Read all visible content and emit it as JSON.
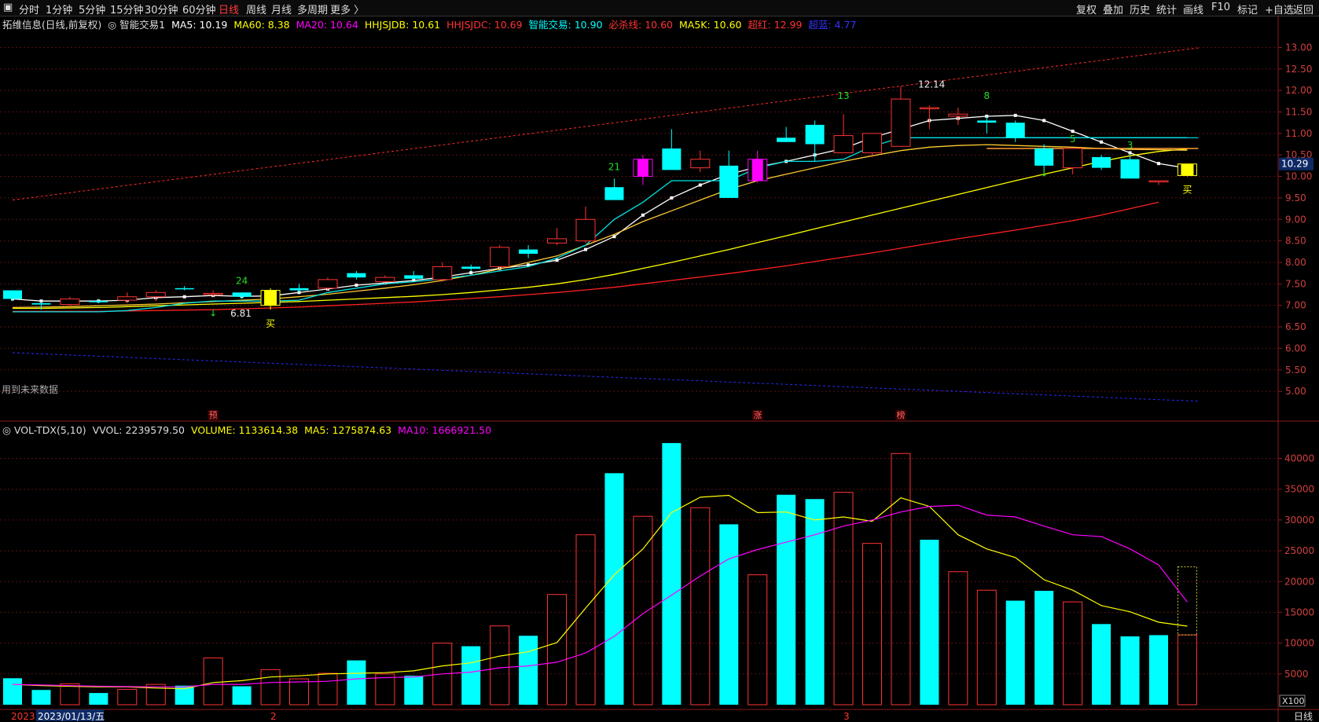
{
  "toolbar": {
    "left": [
      "分时",
      "1分钟",
      "5分钟",
      "15分钟",
      "30分钟",
      "60分钟",
      "日线",
      "周线",
      "月线",
      "多周期",
      "更多 〉"
    ],
    "active": "日线",
    "right": [
      "复权",
      "叠加",
      "历史",
      "统计",
      "画线",
      "F10",
      "标记",
      "+自选",
      "返回"
    ]
  },
  "main_legend": [
    {
      "text": "拓维信息(日线,前复权)",
      "color": "#dddddd"
    },
    {
      "text": "◎ 智能交易1",
      "color": "#dddddd"
    },
    {
      "text": "MA5: 10.19",
      "color": "#ffffff"
    },
    {
      "text": "MA60: 8.38",
      "color": "#ffff00"
    },
    {
      "text": "MA20: 10.64",
      "color": "#ff00ff"
    },
    {
      "text": "HHJSJDB: 10.61",
      "color": "#ffff00"
    },
    {
      "text": "HHJSJDC: 10.69",
      "color": "#ff3333"
    },
    {
      "text": "智能交易: 10.90",
      "color": "#00ffff"
    },
    {
      "text": "必杀线: 10.60",
      "color": "#ff3333"
    },
    {
      "text": "MA5K: 10.60",
      "color": "#ffff00"
    },
    {
      "text": "超红: 12.99",
      "color": "#ff3333"
    },
    {
      "text": "超蓝: 4.77",
      "color": "#3333ff"
    }
  ],
  "vol_legend": [
    {
      "text": "◎ VOL-TDX(5,10)",
      "color": "#dddddd"
    },
    {
      "text": "VVOL: 2239579.50",
      "color": "#dddddd"
    },
    {
      "text": "VOLUME: 1133614.38",
      "color": "#ffff00"
    },
    {
      "text": "MA5: 1275874.63",
      "color": "#ffff00"
    },
    {
      "text": "MA10: 1666921.50",
      "color": "#ff00ff"
    }
  ],
  "notes": {
    "future_data": "用到未来数据",
    "high_label": "12.14",
    "low_label": "6.81",
    "buy_label": "买",
    "last_price": "10.29",
    "vol_unit": "X100",
    "period": "日线",
    "markers": [
      "预",
      "涨",
      "榜"
    ],
    "signal_numbers": [
      "24",
      "21",
      "13",
      "8",
      "5",
      "3"
    ]
  },
  "x_axis": {
    "labels": [
      "2023",
      "2023/01/13/五",
      "2",
      "3"
    ]
  },
  "chart_data": [
    {
      "type": "candlestick",
      "title": "拓维信息(日线,前复权)",
      "ylim": [
        4.6,
        13.3
      ],
      "yticks": [
        "13.00",
        "12.50",
        "12.00",
        "11.50",
        "11.00",
        "10.50",
        "10.00",
        "9.50",
        "9.00",
        "8.50",
        "8.00",
        "7.50",
        "7.00",
        "6.50",
        "6.00",
        "5.50",
        "5.00"
      ],
      "ohlc": [
        [
          7.35,
          7.35,
          7.1,
          7.15
        ],
        [
          7.05,
          7.1,
          6.9,
          7.02
        ],
        [
          7.02,
          7.2,
          6.95,
          7.15
        ],
        [
          7.1,
          7.15,
          7.05,
          7.08
        ],
        [
          7.12,
          7.3,
          7.05,
          7.2
        ],
        [
          7.2,
          7.35,
          7.1,
          7.3
        ],
        [
          7.4,
          7.45,
          7.35,
          7.38
        ],
        [
          7.25,
          7.35,
          7.2,
          7.28
        ],
        [
          7.3,
          7.3,
          7.15,
          7.2
        ],
        [
          7.0,
          7.4,
          6.9,
          7.35
        ],
        [
          7.4,
          7.5,
          7.3,
          7.35
        ],
        [
          7.4,
          7.65,
          7.35,
          7.6
        ],
        [
          7.75,
          7.8,
          7.6,
          7.65
        ],
        [
          7.55,
          7.7,
          7.5,
          7.65
        ],
        [
          7.7,
          7.8,
          7.6,
          7.62
        ],
        [
          7.6,
          8.0,
          7.55,
          7.9
        ],
        [
          7.9,
          7.95,
          7.8,
          7.85
        ],
        [
          7.9,
          8.4,
          7.85,
          8.35
        ],
        [
          8.3,
          8.4,
          8.1,
          8.2
        ],
        [
          8.45,
          8.8,
          8.4,
          8.55
        ],
        [
          8.5,
          9.3,
          8.45,
          9.0
        ],
        [
          9.75,
          9.95,
          9.55,
          9.45
        ],
        [
          10.0,
          10.5,
          9.8,
          10.4
        ],
        [
          10.65,
          11.1,
          10.15,
          10.15
        ],
        [
          10.2,
          10.6,
          10.1,
          10.4
        ],
        [
          10.25,
          10.6,
          9.5,
          9.5
        ],
        [
          9.9,
          10.6,
          9.85,
          10.4
        ],
        [
          10.9,
          11.15,
          10.8,
          10.8
        ],
        [
          11.2,
          11.3,
          10.35,
          10.75
        ],
        [
          10.55,
          11.45,
          10.55,
          10.95
        ],
        [
          10.55,
          11.0,
          10.45,
          11.0
        ],
        [
          10.7,
          12.1,
          10.7,
          11.8
        ],
        [
          11.6,
          11.65,
          11.1,
          11.6
        ],
        [
          11.4,
          11.6,
          11.2,
          11.45
        ],
        [
          11.3,
          11.4,
          11.0,
          11.25
        ],
        [
          11.25,
          11.3,
          10.8,
          10.9
        ],
        [
          10.65,
          10.75,
          10.1,
          10.25
        ],
        [
          10.2,
          10.65,
          10.05,
          10.65
        ],
        [
          10.45,
          10.5,
          10.15,
          10.2
        ],
        [
          10.4,
          10.5,
          9.95,
          9.95
        ],
        [
          9.9,
          9.9,
          9.8,
          9.9
        ],
        [
          10.02,
          10.29,
          10.0,
          10.29
        ]
      ],
      "series": [
        {
          "name": "MA5",
          "values": [
            7.15,
            7.1,
            7.1,
            7.1,
            7.12,
            7.18,
            7.2,
            7.23,
            7.21,
            7.22,
            7.3,
            7.38,
            7.47,
            7.52,
            7.58,
            7.66,
            7.76,
            7.86,
            7.94,
            8.05,
            8.3,
            8.6,
            9.1,
            9.5,
            9.8,
            10.05,
            10.22,
            10.35,
            10.5,
            10.65,
            10.9,
            11.1,
            11.3,
            11.35,
            11.4,
            11.42,
            11.3,
            11.05,
            10.8,
            10.55,
            10.3,
            10.19
          ]
        },
        {
          "name": "MA60",
          "values": [
            6.86,
            6.86,
            6.86,
            6.86,
            6.87,
            6.88,
            6.89,
            6.9,
            6.92,
            6.94,
            6.96,
            6.99,
            7.02,
            7.05,
            7.08,
            7.12,
            7.16,
            7.2,
            7.25,
            7.3,
            7.36,
            7.42,
            7.5,
            7.58,
            7.66,
            7.74,
            7.83,
            7.92,
            8.02,
            8.12,
            8.22,
            8.33,
            8.44,
            8.55,
            8.65,
            8.75,
            8.86,
            8.97,
            9.1,
            9.25,
            9.4,
            8.38
          ]
        },
        {
          "name": "MA20",
          "values": [
            6.93,
            6.93,
            6.94,
            6.95,
            6.97,
            6.99,
            7.01,
            7.03,
            7.05,
            7.07,
            7.09,
            7.12,
            7.15,
            7.18,
            7.21,
            7.25,
            7.3,
            7.36,
            7.42,
            7.5,
            7.6,
            7.72,
            7.86,
            8.0,
            8.15,
            8.3,
            8.46,
            8.62,
            8.78,
            8.94,
            9.1,
            9.26,
            9.42,
            9.58,
            9.74,
            9.9,
            10.05,
            10.2,
            10.35,
            10.48,
            10.58,
            10.64
          ]
        },
        {
          "name": "HHJSJDB",
          "values": [
            6.95,
            6.96,
            6.97,
            6.99,
            7.01,
            7.03,
            7.06,
            7.09,
            7.12,
            7.15,
            7.2,
            7.26,
            7.33,
            7.4,
            7.48,
            7.58,
            7.7,
            7.85,
            8.0,
            8.15,
            8.4,
            8.65,
            8.95,
            9.2,
            9.45,
            9.7,
            9.9,
            10.05,
            10.2,
            10.35,
            10.48,
            10.6,
            10.68,
            10.72,
            10.74,
            10.72,
            10.7,
            10.68,
            10.65,
            10.63,
            10.62,
            10.61
          ]
        },
        {
          "name": "智能交易",
          "values": [
            6.85,
            6.85,
            6.85,
            6.85,
            6.88,
            6.95,
            7.05,
            7.1,
            7.1,
            7.1,
            7.12,
            7.3,
            7.4,
            7.5,
            7.55,
            7.62,
            7.7,
            7.8,
            7.9,
            8.1,
            8.4,
            9.0,
            9.4,
            9.9,
            9.9,
            9.9,
            10.2,
            10.35,
            10.35,
            10.4,
            10.7,
            10.9,
            10.9,
            10.9,
            10.9,
            10.9,
            10.9,
            10.9,
            10.9,
            10.9,
            10.9,
            10.9
          ]
        }
      ],
      "trend_lines": [
        {
          "name": "超红",
          "from": [
            0,
            9.45
          ],
          "to": [
            41,
            12.99
          ]
        },
        {
          "name": "超蓝",
          "from": [
            0,
            5.9
          ],
          "to": [
            41,
            4.77
          ]
        }
      ]
    },
    {
      "type": "bar",
      "title": "VOL-TDX(5,10)",
      "ylim": [
        0,
        43000
      ],
      "yticks": [
        "40000",
        "35000",
        "30000",
        "25000",
        "20000",
        "15000",
        "10000",
        "5000"
      ],
      "values": [
        4300,
        2400,
        3400,
        1900,
        2500,
        3300,
        3100,
        7600,
        3000,
        5700,
        4200,
        5100,
        7200,
        5000,
        4700,
        10000,
        9500,
        12800,
        11200,
        17900,
        27600,
        37600,
        30600,
        42500,
        32000,
        29300,
        21100,
        34100,
        33400,
        34500,
        26200,
        40800,
        26800,
        21600,
        18600,
        16900,
        18500,
        16700,
        13100,
        11100,
        11300,
        11340
      ],
      "up": [
        false,
        false,
        true,
        false,
        true,
        true,
        false,
        true,
        false,
        true,
        true,
        true,
        false,
        true,
        false,
        true,
        false,
        true,
        false,
        true,
        true,
        false,
        true,
        false,
        true,
        false,
        true,
        false,
        false,
        true,
        true,
        true,
        false,
        true,
        true,
        false,
        false,
        true,
        false,
        false,
        false,
        true
      ],
      "ma5": [
        3300,
        3100,
        3000,
        2900,
        2900,
        2700,
        2600,
        3600,
        3900,
        4500,
        4700,
        5000,
        5100,
        5200,
        5500,
        6300,
        6800,
        7900,
        8600,
        10100,
        15700,
        21100,
        25300,
        31200,
        33700,
        34000,
        31200,
        31300,
        30000,
        30500,
        29800,
        33600,
        32200,
        27600,
        25300,
        23900,
        20300,
        18600,
        16100,
        15100,
        13400,
        12760
      ],
      "ma10": [
        3300,
        3200,
        3100,
        3000,
        2950,
        2900,
        2900,
        3300,
        3300,
        3600,
        3700,
        3800,
        4200,
        4400,
        4500,
        5000,
        5300,
        6000,
        6300,
        6900,
        8400,
        11100,
        14800,
        17800,
        20900,
        23700,
        25200,
        26400,
        27600,
        29000,
        30000,
        31300,
        32200,
        32400,
        30800,
        30500,
        29000,
        27600,
        27300,
        25300,
        22700,
        16670
      ]
    }
  ]
}
